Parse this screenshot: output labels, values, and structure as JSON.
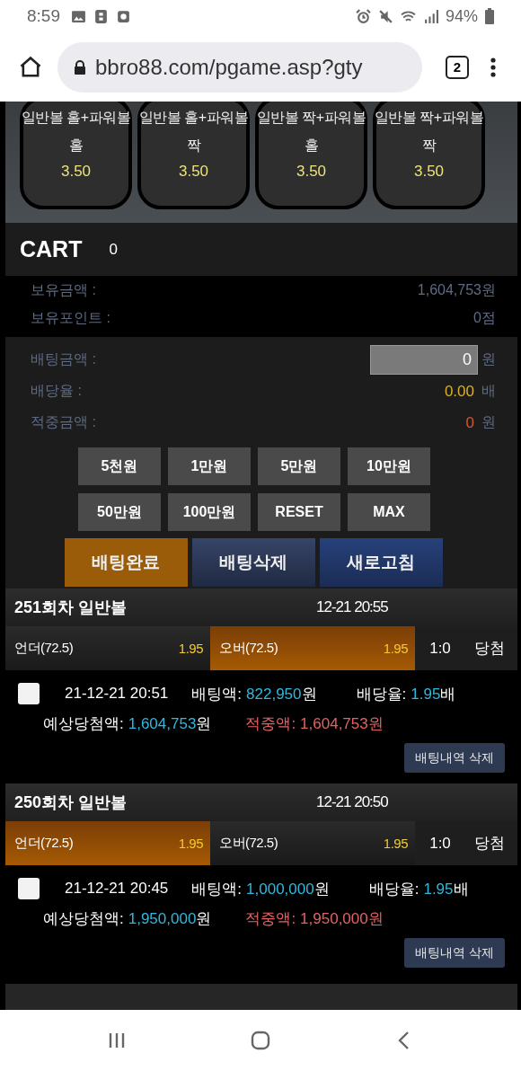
{
  "status_bar": {
    "time": "8:59",
    "battery": "94%"
  },
  "browser": {
    "url": "bbro88.com/pgame.asp?gty",
    "tab_count": "2"
  },
  "odds_cards": [
    {
      "title": "일반볼 홀+파워볼",
      "pick": "홀",
      "odds": "3.50"
    },
    {
      "title": "일반볼 홀+파워볼",
      "pick": "짝",
      "odds": "3.50"
    },
    {
      "title": "일반볼 짝+파워볼",
      "pick": "홀",
      "odds": "3.50"
    },
    {
      "title": "일반볼 짝+파워볼",
      "pick": "짝",
      "odds": "3.50"
    }
  ],
  "cart": {
    "title": "CART",
    "count": "0"
  },
  "balance": [
    {
      "label": "보유금액 :",
      "value": "1,604,753원"
    },
    {
      "label": "보유포인트 :",
      "value": "0점"
    }
  ],
  "bet_form": [
    {
      "kind": "input",
      "label": "배팅금액 :",
      "value": "0",
      "unit": "원"
    },
    {
      "kind": "rate",
      "label": "배당율 :",
      "value": "0.00",
      "unit": "배"
    },
    {
      "kind": "win",
      "label": "적중금액 :",
      "value": "0",
      "unit": "원"
    }
  ],
  "amount_buttons": [
    "5천원",
    "1만원",
    "5만원",
    "10만원",
    "50만원",
    "100만원",
    "RESET",
    "MAX"
  ],
  "actions": [
    {
      "kind": "complete",
      "label": "배팅완료"
    },
    {
      "kind": "delete",
      "label": "배팅삭제"
    },
    {
      "kind": "refresh",
      "label": "새로고침"
    }
  ],
  "games": [
    {
      "title": "251회차 일반볼",
      "time": "12-21 20:55",
      "options": [
        {
          "label": "언더(72.5)",
          "odds": "1.95",
          "selected": false
        },
        {
          "label": "오버(72.5)",
          "odds": "1.95",
          "selected": true
        }
      ],
      "score": "1:0",
      "result": "당첨",
      "bet": {
        "checked": false,
        "datetime": "21-12-21 20:51",
        "fields": [
          {
            "kind": "info",
            "label": "배팅액:",
            "value": "822,950",
            "unit": "원"
          },
          {
            "kind": "info",
            "label": "배당율:",
            "value": "1.95",
            "unit": "배"
          },
          {
            "kind": "info",
            "label": "예상당첨액:",
            "value": "1,604,753",
            "unit": "원"
          },
          {
            "kind": "hit",
            "label": "적중액:",
            "value": "1,604,753",
            "unit": "원"
          }
        ],
        "button": "배팅내역 삭제"
      }
    },
    {
      "title": "250회차 일반볼",
      "time": "12-21 20:50",
      "options": [
        {
          "label": "언더(72.5)",
          "odds": "1.95",
          "selected": true
        },
        {
          "label": "오버(72.5)",
          "odds": "1.95",
          "selected": false
        }
      ],
      "score": "1:0",
      "result": "당첨",
      "bet": {
        "checked": false,
        "datetime": "21-12-21 20:45",
        "fields": [
          {
            "kind": "info",
            "label": "배팅액:",
            "value": "1,000,000",
            "unit": "원"
          },
          {
            "kind": "info",
            "label": "배당율:",
            "value": "1.95",
            "unit": "배"
          },
          {
            "kind": "info",
            "label": "예상당첨액:",
            "value": "1,950,000",
            "unit": "원"
          },
          {
            "kind": "hit",
            "label": "적중액:",
            "value": "1,950,000",
            "unit": "원"
          }
        ],
        "button": "배팅내역 삭제"
      }
    }
  ]
}
